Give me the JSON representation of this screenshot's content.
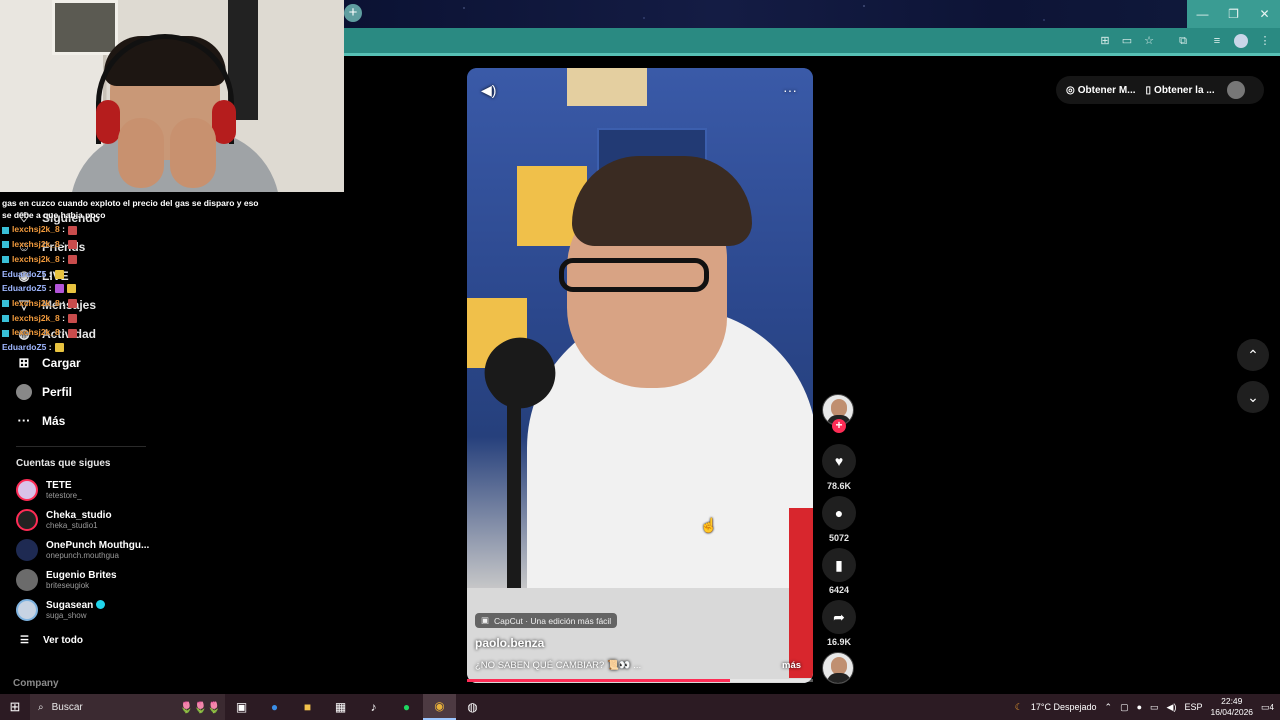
{
  "browser": {
    "new_tab_icon": "plus-icon",
    "window_controls": [
      "—",
      "❐",
      "✕"
    ],
    "toolbar_icons": [
      "translate-icon",
      "cast-icon",
      "star-icon",
      "extensions-icon",
      "media-icon",
      "profile-icon",
      "menu-icon"
    ]
  },
  "chat": {
    "top_message": "gas en cuzco cuando exploto el precio del gas se disparo y eso",
    "top_message_line2": "se debe a que habia poco",
    "lines": [
      {
        "user": "lexchsj2k_8",
        "sep": " :",
        "color": "u1"
      },
      {
        "user": "lexchsj2k_8",
        "sep": " :",
        "color": "u1"
      },
      {
        "user": "lexchsj2k_8",
        "sep": " :",
        "color": "u1"
      },
      {
        "user": "EduardoZ5",
        "sep": " :",
        "color": "u2"
      },
      {
        "user": "EduardoZ5",
        "sep": " :",
        "color": "u2"
      },
      {
        "user": "lexchsj2k_8",
        "sep": " :",
        "color": "u1"
      },
      {
        "user": "lexchsj2k_8",
        "sep": " :",
        "color": "u1"
      },
      {
        "user": "lexchsj2k_8",
        "sep": " :",
        "color": "u1"
      },
      {
        "user": "EduardoZ5",
        "sep": " :",
        "color": "u2"
      }
    ]
  },
  "sidebar": {
    "nav": [
      {
        "label": "Siguiendo",
        "icon": "following-icon"
      },
      {
        "label": "Friends",
        "icon": "friends-icon"
      },
      {
        "label": "LIVE",
        "icon": "live-icon"
      },
      {
        "label": "Mensajes",
        "icon": "messages-icon"
      },
      {
        "label": "Actividad",
        "icon": "activity-icon"
      },
      {
        "label": "Cargar",
        "icon": "upload-icon"
      },
      {
        "label": "Perfil",
        "icon": "profile-icon"
      },
      {
        "label": "Más",
        "icon": "more-icon"
      }
    ],
    "following_title": "Cuentas que sigues",
    "accounts": [
      {
        "name": "TETE",
        "handle": "tetestore_",
        "verified": false
      },
      {
        "name": "Cheka_studio",
        "handle": "cheka_studio1",
        "verified": false
      },
      {
        "name": "OnePunch Mouthgu...",
        "handle": "onepunch.mouthgua",
        "verified": false
      },
      {
        "name": "Eugenio Brites",
        "handle": "briteseugiok",
        "verified": false
      },
      {
        "name": "Sugasean",
        "handle": "suga_show",
        "verified": true
      }
    ],
    "see_all": "Ver todo",
    "company": "Company"
  },
  "video": {
    "caption_badge": "CapCut · Una edición más fácil",
    "author": "paolo.benza",
    "description": "¿NO SABEN QUÉ CAMBIAR? 📜👀 ...",
    "more": "más",
    "progress": 0.76
  },
  "actions": {
    "likes": "78.6K",
    "comments": "5072",
    "saves": "6424",
    "shares": "16.9K"
  },
  "topright": {
    "get_app_1": "Obtener M...",
    "get_app_2": "Obtener la ..."
  },
  "taskbar": {
    "search_placeholder": "Buscar",
    "weather": "17°C  Despejado",
    "language": "ESP",
    "time": "22:49",
    "date": "16/04/2026",
    "notifications": "4"
  }
}
